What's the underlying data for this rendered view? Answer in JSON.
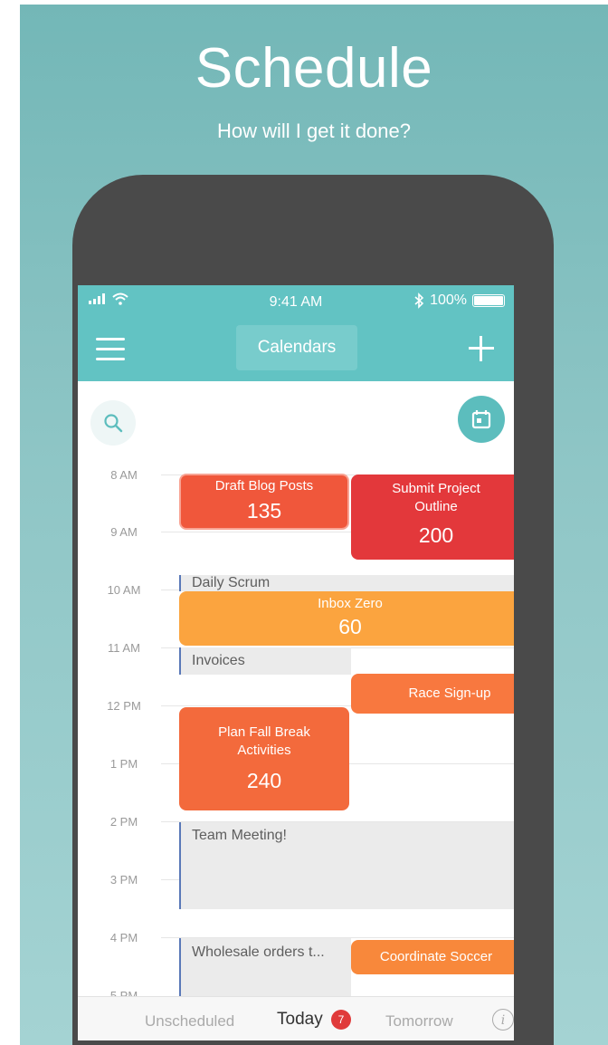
{
  "promo": {
    "headline": "Schedule",
    "subheadline": "How will I get it done?"
  },
  "status_bar": {
    "time": "9:41 AM",
    "battery": "100%",
    "battery_level": 1.0
  },
  "nav": {
    "calendars_label": "Calendars"
  },
  "timeline": {
    "hours": [
      "8 AM",
      "9 AM",
      "10 AM",
      "11 AM",
      "12 PM",
      "1 PM",
      "2 PM",
      "3 PM",
      "4 PM",
      "5 PM"
    ]
  },
  "events": {
    "draft_blog": {
      "title": "Draft Blog Posts",
      "value": "135"
    },
    "submit_outline": {
      "title": "Submit Project Outline",
      "value": "200"
    },
    "daily_scrum": {
      "title": "Daily Scrum"
    },
    "inbox_zero": {
      "title": "Inbox Zero",
      "value": "60"
    },
    "invoices": {
      "title": "Invoices"
    },
    "race_signup": {
      "title": "Race Sign-up"
    },
    "plan_fall_break": {
      "title": "Plan Fall Break Activities",
      "value": "240"
    },
    "team_meeting": {
      "title": "Team Meeting!"
    },
    "wholesale": {
      "title": "Wholesale orders t..."
    },
    "coordinate_soccer": {
      "title": "Coordinate Soccer"
    }
  },
  "tabs": {
    "unscheduled": "Unscheduled",
    "today": "Today",
    "today_badge": "7",
    "tomorrow": "Tomorrow",
    "info": "i"
  },
  "colors": {
    "background_teal": "#80bfbf",
    "nav_teal": "#62c3c3",
    "phone_frame": "#4a4a4a",
    "event_orange_red": "#f0573b",
    "event_red": "#e3383b",
    "event_orange": "#fba43f",
    "event_orange_mid": "#f8783f",
    "badge_red": "#e03a3a",
    "calendar_line_blue": "#5a79b8"
  },
  "icons": {
    "signal": "signal-icon",
    "wifi": "wifi-icon",
    "bluetooth": "bluetooth-icon",
    "battery": "battery-icon",
    "menu": "hamburger-menu-icon",
    "add": "plus-icon",
    "search": "search-icon",
    "calendar": "calendar-icon",
    "info": "info-icon"
  }
}
